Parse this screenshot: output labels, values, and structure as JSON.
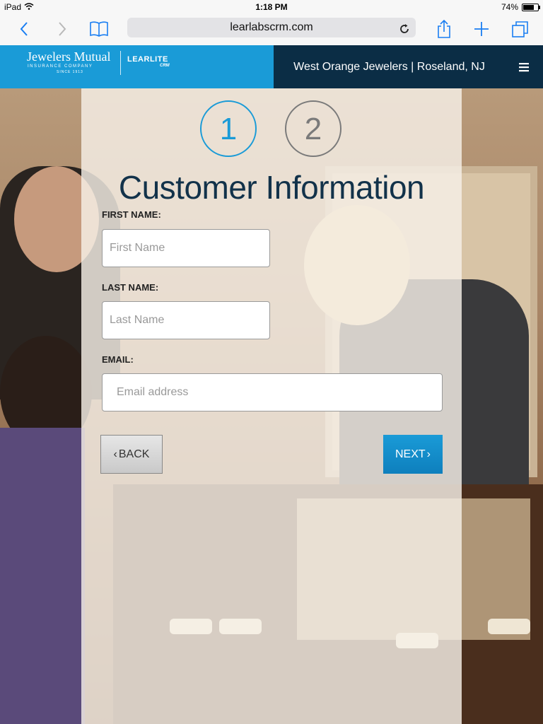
{
  "status_bar": {
    "device": "iPad",
    "time": "1:18 PM",
    "battery": "74%",
    "battery_level": 0.74
  },
  "browser": {
    "url": "learlabscrm.com"
  },
  "header": {
    "brand_name": "Jewelers Mutual",
    "brand_subtitle": "INSURANCE COMPANY",
    "brand_since": "SINCE 1913",
    "product_name": "LEARLITE",
    "product_suffix": "CRM",
    "store": "West Orange Jewelers | Roseland, NJ"
  },
  "steps": [
    {
      "label": "1",
      "active": true
    },
    {
      "label": "2",
      "active": false
    }
  ],
  "form": {
    "title": "Customer Information",
    "first_name_label": "FIRST NAME:",
    "first_name_placeholder": "First Name",
    "last_name_label": "LAST NAME:",
    "last_name_placeholder": "Last Name",
    "email_label": "EMAIL:",
    "email_placeholder": "Email address",
    "back_label": "BACK",
    "next_label": "NEXT"
  },
  "colors": {
    "accent": "#1a9bd7",
    "header_dark": "#0b2d45",
    "title": "#12324a"
  }
}
